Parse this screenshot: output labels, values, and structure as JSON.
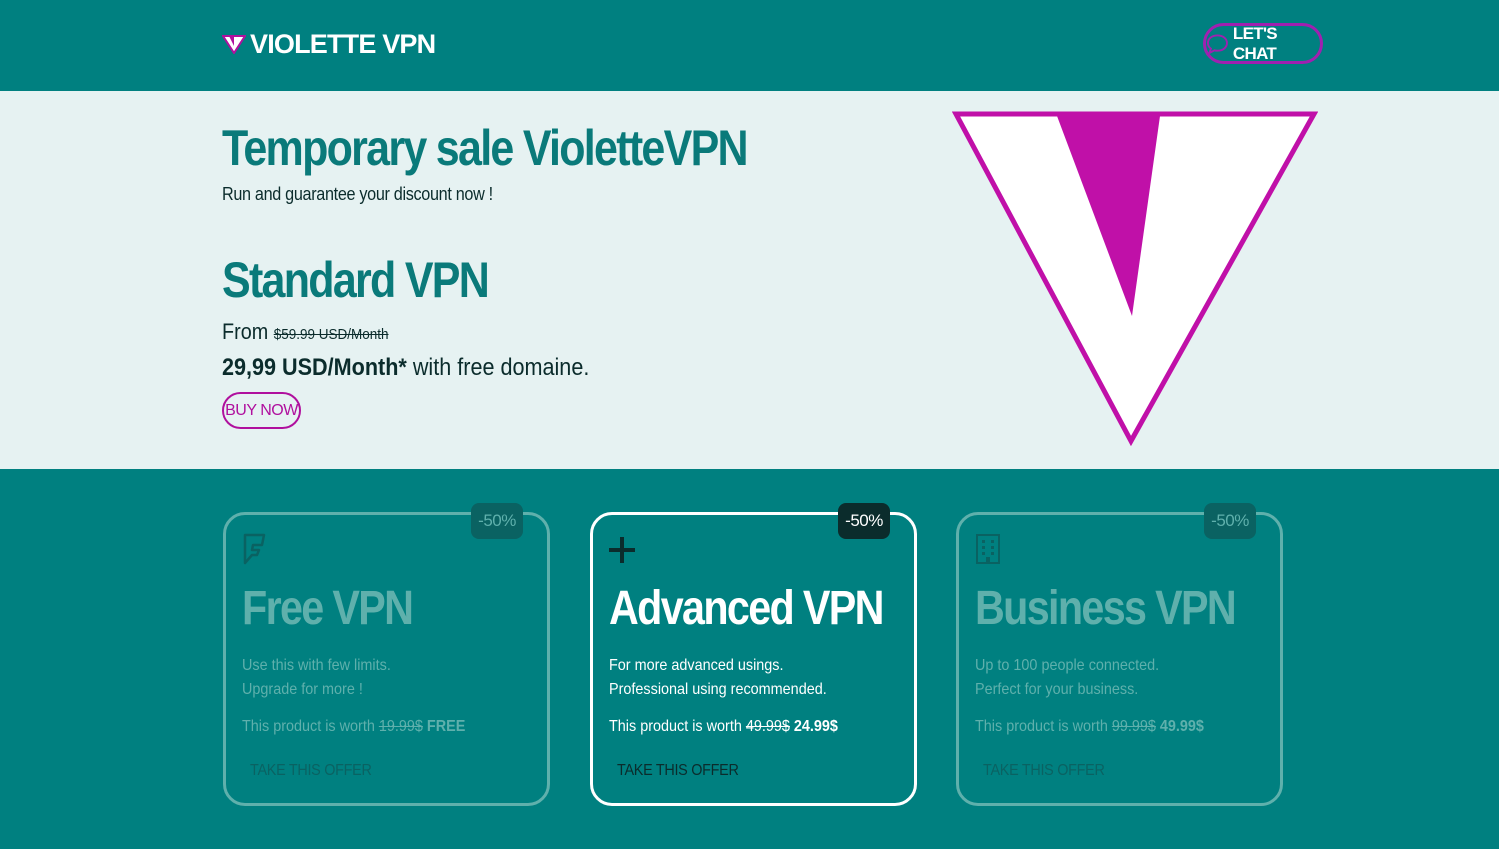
{
  "header": {
    "brand": "VIOLETTE VPN",
    "chat_label": "LET'S CHAT"
  },
  "hero": {
    "title": "Temporary sale VioletteVPN",
    "subtitle": "Run and guarantee your discount now !",
    "plan_title": "Standard VPN",
    "from_label": "From",
    "old_price": "$59.99 USD/Month",
    "price": "29,99 USD/Month*",
    "price_suffix": " with free domaine.",
    "buy_label": "BUY NOW"
  },
  "cards": [
    {
      "badge": "-50%",
      "title": "Free VPN",
      "desc_line1": "Use this with few limits.",
      "desc_line2": "Upgrade for more !",
      "worth_label": "This product is worth ",
      "old_price": "19.99$",
      "new_price": " FREE",
      "offer_label": "TAKE THIS OFFER",
      "icon": "foursquare-icon"
    },
    {
      "badge": "-50%",
      "title": "Advanced VPN",
      "desc_line1": "For more advanced usings.",
      "desc_line2": "Professional using recommended.",
      "worth_label": "This product is worth ",
      "old_price": "49.99$",
      "new_price": " 24.99$",
      "offer_label": "TAKE THIS OFFER",
      "icon": "plus-icon"
    },
    {
      "badge": "-50%",
      "title": "Business VPN",
      "desc_line1": "Up to 100 people connected.",
      "desc_line2": "Perfect for your business.",
      "worth_label": "This product is worth ",
      "old_price": "99.99$",
      "new_price": " 49.99$",
      "offer_label": "TAKE THIS OFFER",
      "icon": "building-icon"
    }
  ],
  "colors": {
    "primary": "#008080",
    "hero_bg": "#e6f2f2",
    "accent": "#b0109e",
    "heading": "#0a7a7a",
    "muted": "#5fb0ac"
  }
}
